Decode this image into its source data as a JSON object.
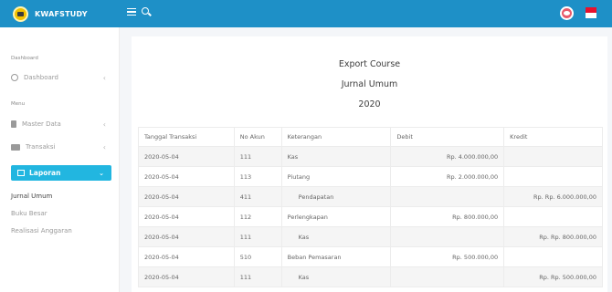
{
  "brand": {
    "name": "KWAFSTUDY"
  },
  "sidebar": {
    "section_dashboard": "Dashboard",
    "item_dashboard": "Dashboard",
    "section_menu": "Menu",
    "item_master": "Master Data",
    "item_transaksi": "Transaksi",
    "item_laporan": "Laporan",
    "sub_items": [
      "Jurnal Umum",
      "Buku Besar",
      "Realisasi Anggaran"
    ]
  },
  "report": {
    "title": "Export Course",
    "subtitle": "Jurnal Umum",
    "year": "2020"
  },
  "table": {
    "headers": [
      "Tanggal Transaksi",
      "No Akun",
      "Keterangan",
      "Debit",
      "Kredit"
    ],
    "rows": [
      {
        "date": "2020-05-04",
        "account": "111",
        "desc": "Kas",
        "debit": "Rp. 4.000.000,00",
        "credit": ""
      },
      {
        "date": "2020-05-04",
        "account": "113",
        "desc": "Piutang",
        "debit": "Rp. 2.000.000,00",
        "credit": ""
      },
      {
        "date": "2020-05-04",
        "account": "411",
        "desc": "Pendapatan",
        "debit": "",
        "credit": "Rp. Rp. 6.000.000,00"
      },
      {
        "date": "2020-05-04",
        "account": "112",
        "desc": "Perlengkapan",
        "debit": "Rp. 800.000,00",
        "credit": ""
      },
      {
        "date": "2020-05-04",
        "account": "111",
        "desc": "Kas",
        "debit": "",
        "credit": "Rp. Rp. 800.000,00"
      },
      {
        "date": "2020-05-04",
        "account": "510",
        "desc": "Beban Pemasaran",
        "debit": "Rp. 500.000,00",
        "credit": ""
      },
      {
        "date": "2020-05-04",
        "account": "111",
        "desc": "Kas",
        "debit": "",
        "credit": "Rp. Rp. 500.000,00"
      }
    ]
  },
  "colors": {
    "topbar": "#1e90c7",
    "active": "#22b6e0"
  }
}
